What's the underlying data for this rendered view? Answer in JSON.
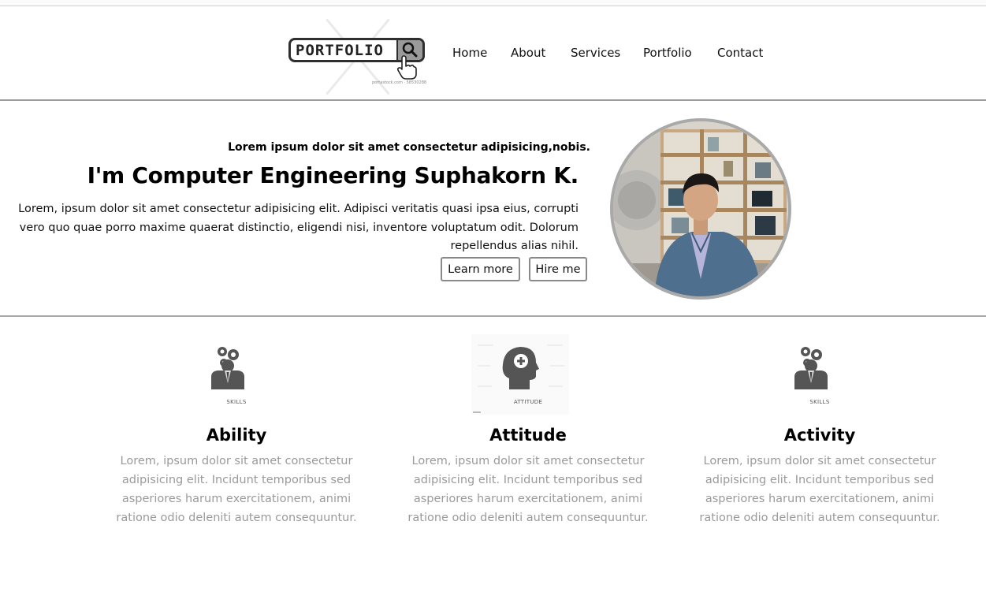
{
  "header": {
    "logo": {
      "text": "PORTFOLIO",
      "caption": "portastock.com · 58530288"
    },
    "nav": [
      {
        "label": "Home"
      },
      {
        "label": "About"
      },
      {
        "label": "Services"
      },
      {
        "label": "Portfolio"
      },
      {
        "label": "Contact"
      }
    ]
  },
  "hero": {
    "kicker": "Lorem ipsum dolor sit amet consectetur adipisicing,nobis.",
    "title": "I'm Computer Engineering Suphakorn K.",
    "text": "Lorem, ipsum dolor sit amet consectetur adipisicing elit. Adipisci veritatis quasi ipsa eius, corrupti vero quo quae porro maxime quaerat distinctio, eligendi nisi, inventore voluptatum odit. Dolorum repellendus alias nihil.",
    "buttons": {
      "learn_more": "Learn more",
      "hire_me": "Hire me"
    }
  },
  "features": [
    {
      "icon": "skills-icon",
      "icon_caption": "SKILLS",
      "title": "Ability",
      "text": "Lorem, ipsum dolor sit amet consectetur adipisicing elit. Incidunt temporibus sed asperiores harum exercitationem, animi ratione odio deleniti autem consequuntur."
    },
    {
      "icon": "attitude-icon",
      "icon_caption": "ATTITUDE",
      "title": "Attitude",
      "text": "Lorem, ipsum dolor sit amet consectetur adipisicing elit. Incidunt temporibus sed asperiores harum exercitationem, animi ratione odio deleniti autem consequuntur."
    },
    {
      "icon": "skills-icon",
      "icon_caption": "SKILLS",
      "title": "Activity",
      "text": "Lorem, ipsum dolor sit amet consectetur adipisicing elit. Incidunt temporibus sed asperiores harum exercitationem, animi ratione odio deleniti autem consequuntur."
    }
  ],
  "colors": {
    "text": "#111111",
    "muted_text": "#9a9a9a",
    "border": "#9c9c9c",
    "icon_gray": "#555555"
  }
}
